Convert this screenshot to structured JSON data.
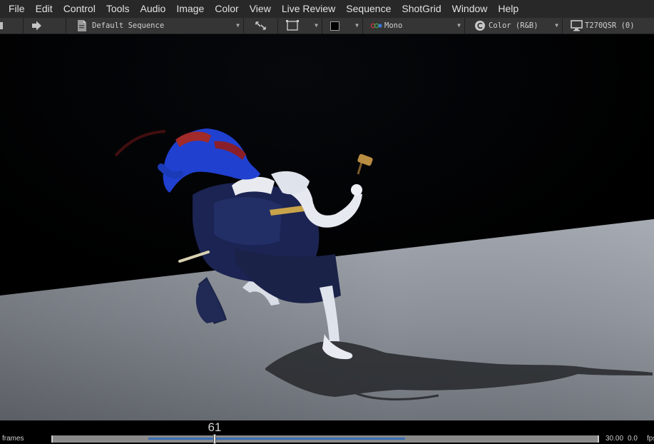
{
  "menu": {
    "items": [
      "File",
      "Edit",
      "Control",
      "Tools",
      "Audio",
      "Image",
      "Color",
      "View",
      "Live Review",
      "Sequence",
      "ShotGrid",
      "Window",
      "Help"
    ]
  },
  "toolbar": {
    "sequence_label": "Default Sequence",
    "channel_label": "Mono",
    "color_label": "Color (R&B)",
    "display_label": "T270QSR (0)",
    "icons": {
      "next": "arrow-right-icon",
      "sequence": "document-icon",
      "fit": "expand-arrows-icon",
      "frame": "frame-icon",
      "swatch": "color-swatch-icon",
      "channel": "rgb-dots-icon",
      "color": "copyright-c-icon",
      "display": "monitor-icon"
    }
  },
  "timeline": {
    "frames_label": "frames",
    "current_frame": "61",
    "fps": "30.00",
    "offset": "0.0",
    "fps_unit": "fps",
    "playhead_fraction": 0.297,
    "range_start_fraction": 0.176,
    "range_end_fraction": 0.647,
    "range_color": "#3a6fb5"
  },
  "viewer": {
    "background": "#000000",
    "floor_color": "#8f949c"
  }
}
